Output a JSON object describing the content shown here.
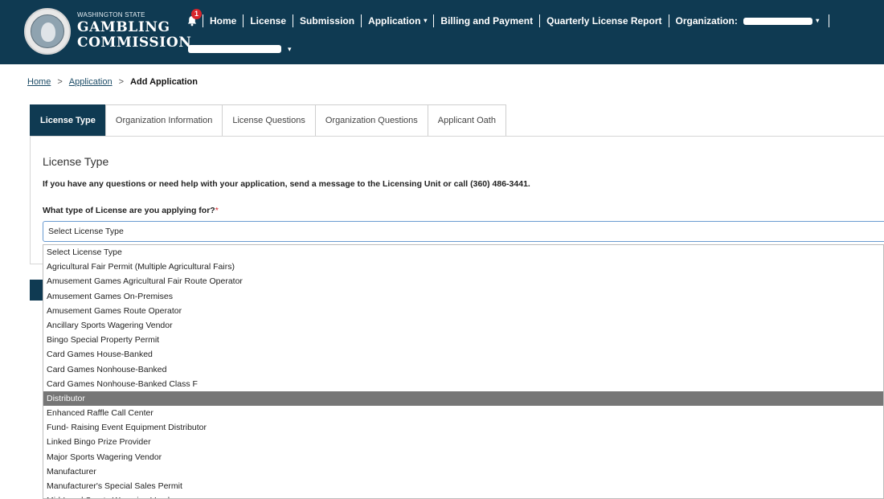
{
  "header": {
    "logo_small": "WASHINGTON STATE",
    "logo_line1": "GAMBLING",
    "logo_line2": "COMMISSION",
    "notification_count": "1",
    "nav": [
      {
        "label": "Home"
      },
      {
        "label": "License"
      },
      {
        "label": "Submission"
      },
      {
        "label": "Application",
        "has_dropdown": true
      },
      {
        "label": "Billing and Payment"
      },
      {
        "label": "Quarterly License Report"
      },
      {
        "label": "Organization:",
        "has_dropdown": true
      }
    ],
    "colors": {
      "header_bg": "#0f3a52",
      "badge": "#d9262c"
    }
  },
  "breadcrumb": {
    "home": "Home",
    "application": "Application",
    "current": "Add Application",
    "separator": ">"
  },
  "tabs": [
    {
      "label": "License Type",
      "active": true
    },
    {
      "label": "Organization Information"
    },
    {
      "label": "License Questions"
    },
    {
      "label": "Organization Questions"
    },
    {
      "label": "Applicant Oath"
    }
  ],
  "form": {
    "title": "License Type",
    "help_text": "If you have any questions or need help with your application, send a message to the Licensing Unit or call (360) 486-3441.",
    "question": "What type of License are you applying for?",
    "required_mark": "*",
    "select_value": "Select License Type"
  },
  "dropdown": {
    "selected_index": 10,
    "options": [
      "Select License Type",
      "Agricultural Fair Permit (Multiple Agricultural Fairs)",
      "Amusement Games Agricultural Fair Route Operator",
      "Amusement Games On-Premises",
      "Amusement Games Route Operator",
      "Ancillary Sports Wagering Vendor",
      "Bingo Special Property Permit",
      "Card Games House-Banked",
      "Card Games Nonhouse-Banked",
      "Card Games Nonhouse-Banked Class F",
      "Distributor",
      "Enhanced Raffle Call Center",
      "Fund- Raising Event Equipment Distributor",
      "Linked Bingo Prize Provider",
      "Major Sports Wagering Vendor",
      "Manufacturer",
      "Manufacturer's Special Sales Permit",
      "Mid-Level Sports Wagering Vendor"
    ]
  }
}
